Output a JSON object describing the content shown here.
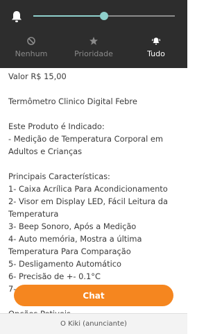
{
  "notifications": {
    "slider_value": 0.5,
    "options": [
      {
        "label": "Nenhum",
        "icon": "block-icon",
        "active": false
      },
      {
        "label": "Prioridade",
        "icon": "star-icon",
        "active": false
      },
      {
        "label": "Tudo",
        "icon": "bell-ringing-icon",
        "active": true
      }
    ],
    "colors": {
      "accent": "#8fd0cc",
      "panel": "#2d2d2d"
    }
  },
  "listing": {
    "price_line": "Valor R$ 15,00",
    "title": "Termômetro Clinico Digital Febre",
    "indication_heading": "Este Produto é Indicado:",
    "indication_text": "- Medição de Temperatura Corporal em Adultos e Crianças",
    "features_heading": "Principais Características:",
    "features": [
      "1- Caixa Acrílica Para Acondicionamento",
      "2- Visor em Display LED, Fácil Leitura da Temperatura",
      "3- Beep Sonoro, Após a Medição",
      "4- Auto memória, Mostra a última Temperatura Para Comparação",
      "5- Desligamento Automático",
      "6- Precisão de +- 0.1°C",
      "7-",
      "Opções Petiveis"
    ]
  },
  "chat_button": {
    "label": "Chat",
    "color": "#f5861f"
  },
  "footer": {
    "seller": "O Kiki (anunciante)"
  }
}
